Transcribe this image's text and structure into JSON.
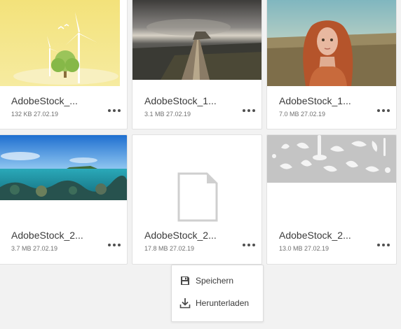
{
  "files": [
    {
      "name": "AdobeStock_...",
      "meta": "132 KB 27.02.19",
      "thumbnail": "windmill-tree-illustration"
    },
    {
      "name": "AdobeStock_1...",
      "meta": "3.1 MB 27.02.19",
      "thumbnail": "coastal-path-sunset"
    },
    {
      "name": "AdobeStock_1...",
      "meta": "7.0 MB 27.02.19",
      "thumbnail": "red-haired-woman-portrait"
    },
    {
      "name": "AdobeStock_2...",
      "meta": "3.7 MB 27.02.19",
      "thumbnail": "coral-reef-panorama"
    },
    {
      "name": "AdobeStock_2...",
      "meta": "17.8 MB 27.02.19",
      "thumbnail": "generic-file-icon"
    },
    {
      "name": "AdobeStock_2...",
      "meta": "13.0 MB 27.02.19",
      "thumbnail": "milk-splashes"
    }
  ],
  "context_menu": {
    "items": [
      {
        "label": "Speichern",
        "icon": "save-icon"
      },
      {
        "label": "Herunterladen",
        "icon": "download-icon"
      }
    ]
  },
  "colors": {
    "background": "#f2f2f2",
    "card": "#ffffff",
    "text": "#3b3b3b",
    "meta_text": "#707070"
  }
}
